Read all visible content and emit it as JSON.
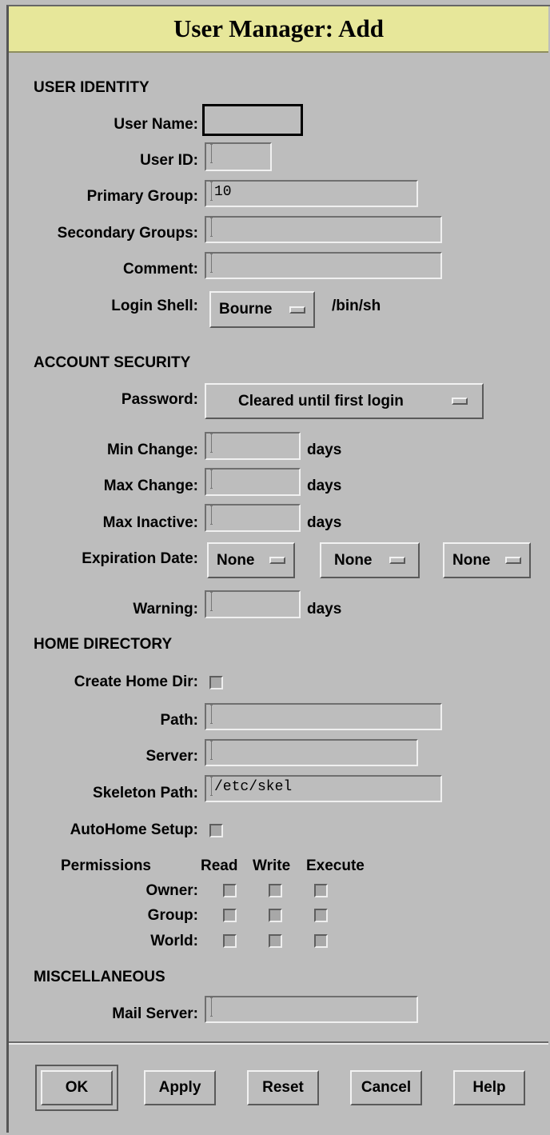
{
  "window": {
    "title": "User Manager: Add"
  },
  "user_identity": {
    "heading": "USER IDENTITY",
    "user_name_label": "User Name:",
    "user_name_value": "",
    "user_id_label": "User ID:",
    "user_id_value": "",
    "primary_group_label": "Primary Group:",
    "primary_group_value": "10",
    "secondary_groups_label": "Secondary Groups:",
    "secondary_groups_value": "",
    "comment_label": "Comment:",
    "comment_value": "",
    "login_shell_label": "Login Shell:",
    "login_shell_option": "Bourne",
    "login_shell_path": "/bin/sh"
  },
  "account_security": {
    "heading": "ACCOUNT SECURITY",
    "password_label": "Password:",
    "password_option": "Cleared until first login",
    "min_change_label": "Min Change:",
    "max_change_label": "Max Change:",
    "max_inactive_label": "Max Inactive:",
    "days_unit": "days",
    "expiration_label": "Expiration Date:",
    "expiration_options": [
      "None",
      "None",
      "None"
    ],
    "warning_label": "Warning:"
  },
  "home_directory": {
    "heading": "HOME DIRECTORY",
    "create_home_label": "Create Home Dir:",
    "create_home_checked": false,
    "path_label": "Path:",
    "path_value": "",
    "server_label": "Server:",
    "server_value": "",
    "skeleton_label": "Skeleton Path:",
    "skeleton_value": "/etc/skel",
    "autohome_label": "AutoHome Setup:",
    "autohome_checked": false,
    "permissions": {
      "header": "Permissions",
      "columns": [
        "Read",
        "Write",
        "Execute"
      ],
      "rows": [
        "Owner:",
        "Group:",
        "World:"
      ]
    }
  },
  "miscellaneous": {
    "heading": "MISCELLANEOUS",
    "mail_server_label": "Mail Server:",
    "mail_server_value": ""
  },
  "buttons": {
    "ok": "OK",
    "apply": "Apply",
    "reset": "Reset",
    "cancel": "Cancel",
    "help": "Help"
  },
  "colors": {
    "background": "#bdbdbd",
    "titlebar": "#e7e79a"
  }
}
